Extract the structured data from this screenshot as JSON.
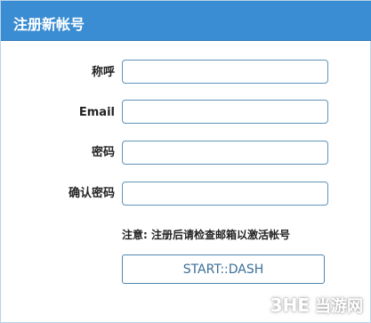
{
  "panel": {
    "title": "注册新帐号"
  },
  "form": {
    "nickname_label": "称呼",
    "nickname_value": "",
    "email_label": "Email",
    "email_value": "",
    "password_label": "密码",
    "password_value": "",
    "confirm_password_label": "确认密码",
    "confirm_password_value": ""
  },
  "notice": {
    "text": "注意: 注册后请检查邮箱以激活帐号"
  },
  "actions": {
    "submit_label": "START::DASH"
  },
  "watermark": {
    "logo_text": "3HE",
    "site_text": "当游网"
  }
}
